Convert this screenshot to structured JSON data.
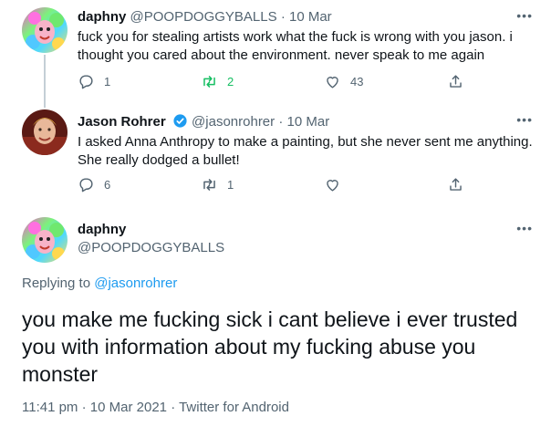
{
  "thread": [
    {
      "name": "daphny",
      "handle": "@POOPDOGGYBALLS",
      "separator": "·",
      "date": "10 Mar",
      "text_lines": [
        "fuck you for stealing artists work what the fuck is wrong with you jason. i",
        "thought you cared about the environment. never speak to me again"
      ],
      "replies": "1",
      "retweets": "2",
      "likes": "43",
      "retweeted": true
    },
    {
      "name": "Jason Rohrer",
      "verified": true,
      "handle": "@jasonrohrer",
      "separator": "·",
      "date": "10 Mar",
      "text_lines": [
        "I asked Anna Anthropy to make a painting, but she never sent me anything.",
        "She really dodged a bullet!"
      ],
      "replies": "6",
      "retweets": "1",
      "likes": "",
      "retweeted": false
    }
  ],
  "main_tweet": {
    "name": "daphny",
    "handle": "@POOPDOGGYBALLS",
    "replying_prefix": "Replying to",
    "replying_to": "@jasonrohrer",
    "text": "you make me fucking sick i cant believe i ever trusted you with information about my fucking abuse you monster",
    "time": "11:41 pm",
    "separator": "·",
    "date": "10 Mar 2021",
    "source": "Twitter for Android"
  },
  "more_label": "•••",
  "icons": {
    "reply": "reply-icon",
    "retweet": "retweet-icon",
    "like": "heart-icon",
    "share": "share-icon",
    "verified": "verified-badge-icon"
  },
  "colors": {
    "text": "#0f1419",
    "secondary": "#536471",
    "link": "#1d9bf0",
    "retweet_active": "#17bf63",
    "thread_line": "#c4cfd6"
  }
}
